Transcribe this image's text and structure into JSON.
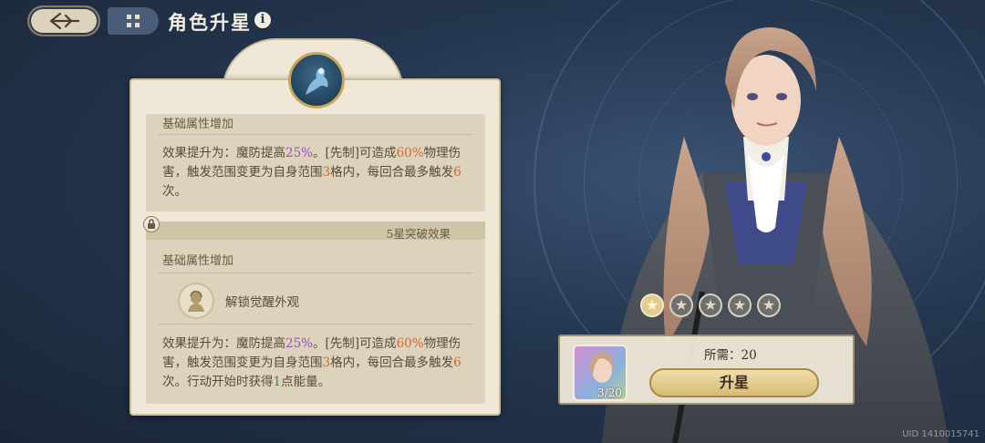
{
  "header": {
    "title": "角色升星",
    "info_symbol": "i"
  },
  "panel": {
    "card1": {
      "title": "基础属性增加",
      "effect_segments": [
        {
          "text": "效果提升为：魔防提高",
          "color": "normal"
        },
        {
          "text": "25%",
          "color": "purple"
        },
        {
          "text": "。[先制]可造成",
          "color": "normal"
        },
        {
          "text": "60%",
          "color": "orange"
        },
        {
          "text": "物理伤害，触发范围变更为自身范围",
          "color": "normal"
        },
        {
          "text": "3",
          "color": "orange"
        },
        {
          "text": "格内，每回合最多触发",
          "color": "normal"
        },
        {
          "text": "6",
          "color": "orange"
        },
        {
          "text": "次。",
          "color": "normal"
        }
      ]
    },
    "card2": {
      "stars": "☆☆☆☆☆",
      "breakthrough_label": "5星突破效果",
      "base_label": "基础属性增加",
      "awaken_label": "解锁觉醒外观",
      "effect_segments": [
        {
          "text": "效果提升为：魔防提高",
          "color": "normal"
        },
        {
          "text": "25%",
          "color": "purple"
        },
        {
          "text": "。[先制]可造成",
          "color": "normal"
        },
        {
          "text": "60%",
          "color": "orange"
        },
        {
          "text": "物理伤害，触发范围变更为自身范围",
          "color": "normal"
        },
        {
          "text": "3",
          "color": "orange"
        },
        {
          "text": "格内，每回合最多触发",
          "color": "normal"
        },
        {
          "text": "6",
          "color": "orange"
        },
        {
          "text": "次。行动开始时获得",
          "color": "normal"
        },
        {
          "text": "1",
          "color": "green"
        },
        {
          "text": "点能量。",
          "color": "normal"
        }
      ]
    }
  },
  "character": {
    "star_level": 1,
    "max_stars": 5
  },
  "upgrade": {
    "shard_count": "3/20",
    "need_label": "所需：20",
    "button_label": "升星"
  },
  "uid": "UID 1410015741",
  "colors": {
    "purple": "#9a4dbf",
    "orange": "#d1692d",
    "green": "#3e8c3e"
  }
}
